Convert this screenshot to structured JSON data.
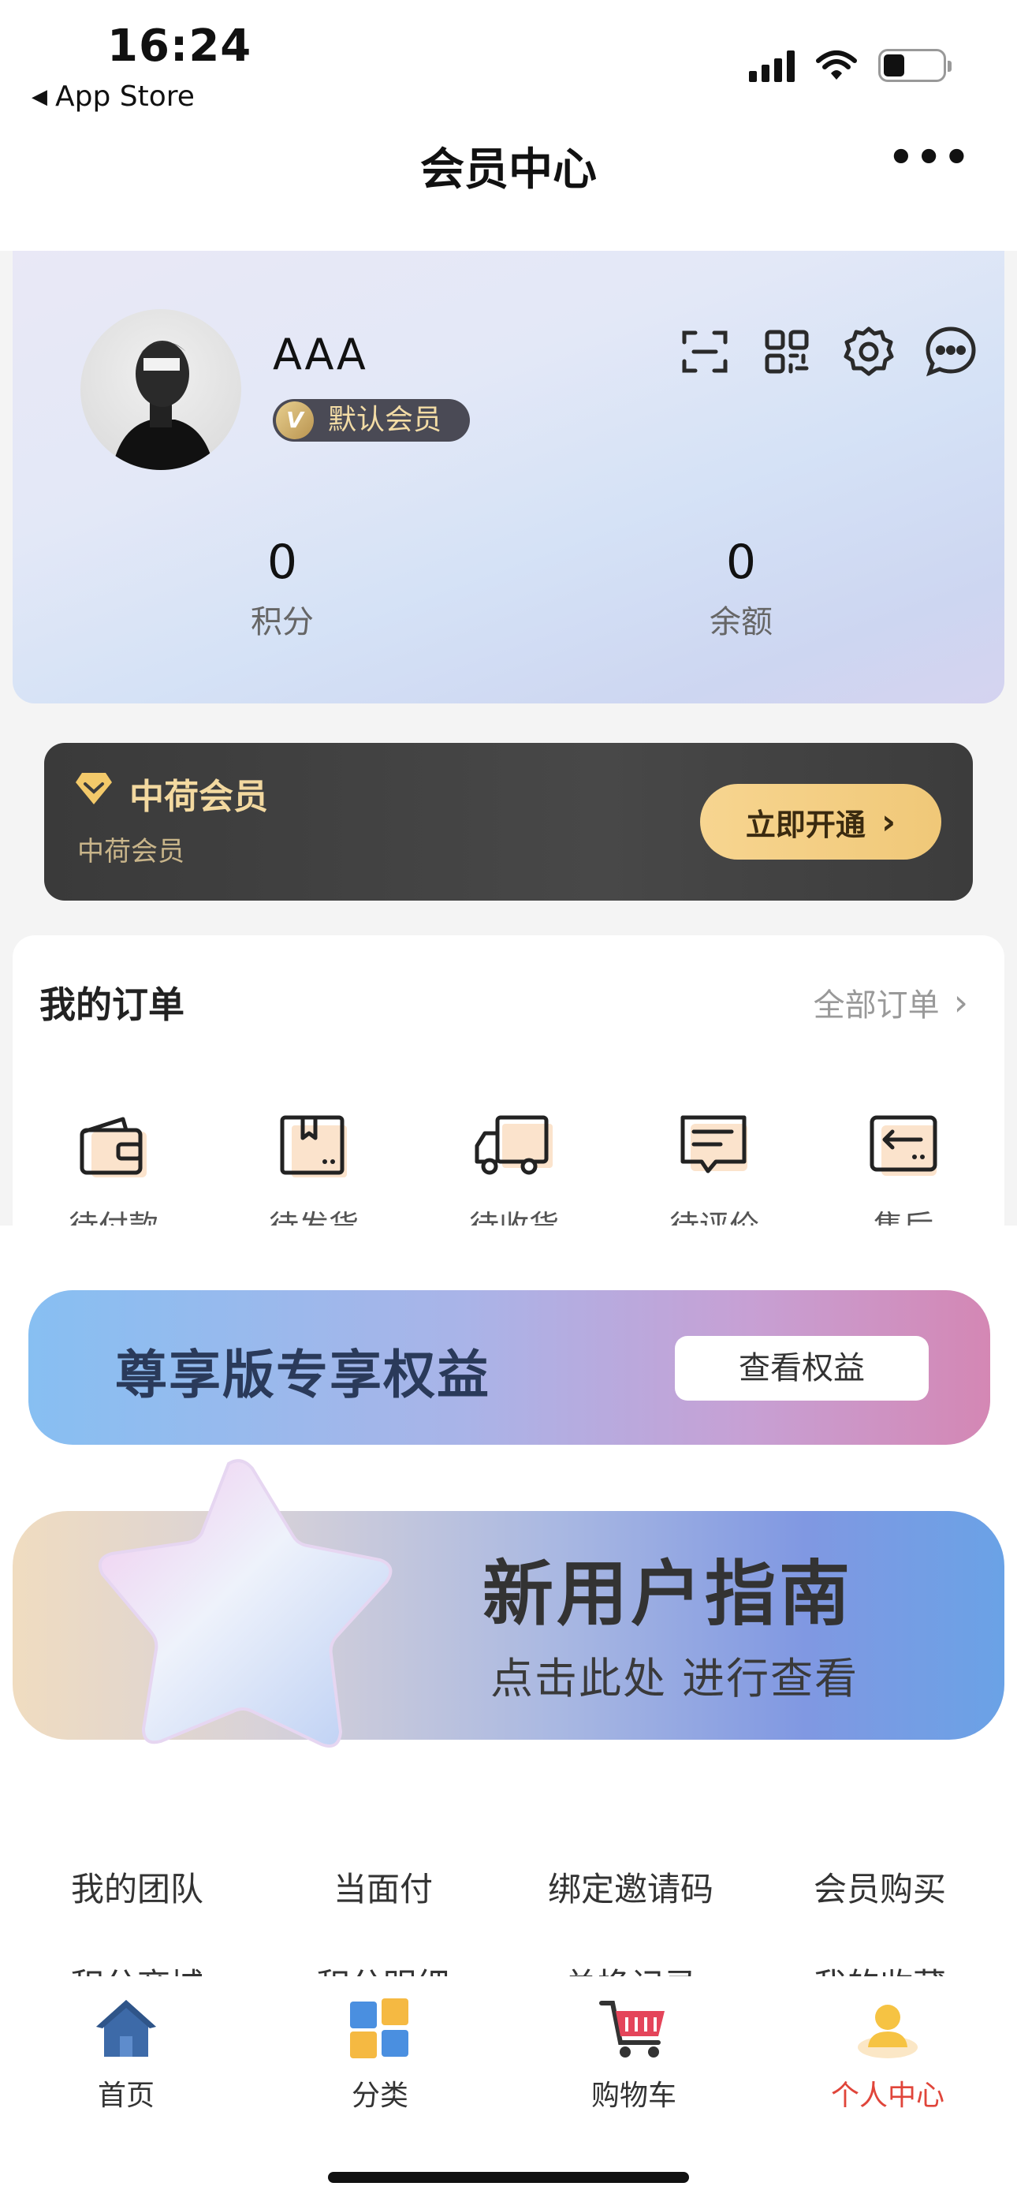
{
  "status_bar": {
    "time": "16:24",
    "back_app": "App Store"
  },
  "nav": {
    "title": "会员中心",
    "more": "•••"
  },
  "profile": {
    "username": "AAA",
    "badge": "默认会员",
    "badge_icon": "V",
    "icons": [
      "scan-icon",
      "qrcode-icon",
      "settings-icon",
      "message-icon"
    ],
    "stats": [
      {
        "value": "0",
        "label": "积分"
      },
      {
        "value": "0",
        "label": "余额"
      }
    ]
  },
  "vip": {
    "title": "中荷会员",
    "subtitle": "中荷会员",
    "button": "立即开通",
    "button_arrow": "›"
  },
  "orders": {
    "title": "我的订单",
    "all": "全部订单",
    "all_arrow": "›",
    "items": [
      {
        "label": "待付款",
        "icon": "wallet-icon"
      },
      {
        "label": "待发货",
        "icon": "box-icon"
      },
      {
        "label": "待收货",
        "icon": "truck-icon"
      },
      {
        "label": "待评价",
        "icon": "comment-icon"
      },
      {
        "label": "售后",
        "icon": "return-icon"
      }
    ]
  },
  "privilege": {
    "title": "尊享版专享权益",
    "button": "查看权益"
  },
  "guide": {
    "title": "新用户指南",
    "subtitle": "点击此处 进行查看"
  },
  "services": {
    "row1": [
      "我的团队",
      "当面付",
      "绑定邀请码",
      "会员购买"
    ],
    "row2": [
      "积分商城",
      "积分明细",
      "兑换记录",
      "我的收藏"
    ]
  },
  "tabs": [
    {
      "label": "首页",
      "icon": "home-icon"
    },
    {
      "label": "分类",
      "icon": "category-icon"
    },
    {
      "label": "购物车",
      "icon": "cart-icon"
    },
    {
      "label": "个人中心",
      "icon": "profile-icon",
      "active": true
    }
  ],
  "colors": {
    "accent": "#e0453a",
    "gold": "#f3d9a0",
    "vip_bg": "#3f3f3f"
  }
}
